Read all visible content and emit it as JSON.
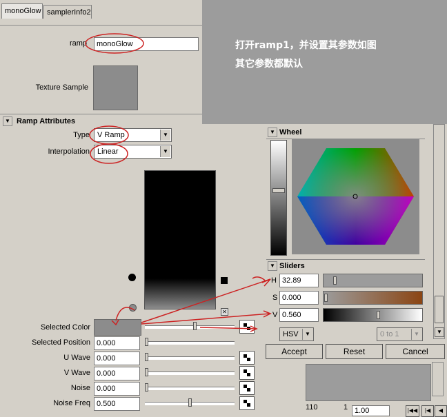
{
  "tabs": [
    "monoGlow",
    "samplerInfo2"
  ],
  "ramp_label": "ramp",
  "ramp_value": "monoGlow",
  "texture_sample_label": "Texture Sample",
  "ramp_attributes": {
    "title": "Ramp Attributes",
    "type_label": "Type",
    "type_value": "V Ramp",
    "interpolation_label": "Interpolation",
    "interpolation_value": "Linear"
  },
  "attributes": [
    {
      "label": "Selected Color",
      "value": ""
    },
    {
      "label": "Selected Position",
      "value": "0.000"
    },
    {
      "label": "U Wave",
      "value": "0.000"
    },
    {
      "label": "V Wave",
      "value": "0.000"
    },
    {
      "label": "Noise",
      "value": "0.000"
    },
    {
      "label": "Noise Freq",
      "value": "0.500"
    }
  ],
  "overlay_text": [
    "打开ramp1，并设置其参数如图",
    "其它参数都默认"
  ],
  "color_chooser": {
    "wheel_title": "Wheel",
    "sliders_title": "Sliders",
    "h_label": "H",
    "h_value": "32.89",
    "s_label": "S",
    "s_value": "0.000",
    "v_label": "V",
    "v_value": "0.560",
    "mode": "HSV",
    "range": "0 to 1",
    "accept": "Accept",
    "reset": "Reset",
    "cancel": "Cancel"
  },
  "bottom": {
    "frame_left": "110",
    "frame_mid": "1",
    "frame_value": "1.00"
  },
  "colors": {
    "annotation_red": "#cc2222",
    "selected_color": "#8c8c8c",
    "overlay_grey": "#9c9c9c",
    "h_slider_brown": "#8b4513"
  }
}
